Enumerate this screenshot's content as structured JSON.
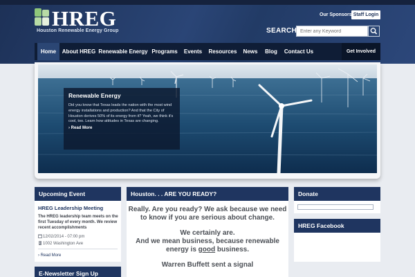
{
  "header": {
    "logo_text": "HREG",
    "logo_subtitle": "Houston Renewable Energy Group",
    "sponsors_link": "Our Sponsors",
    "staff_login": "Staff Login",
    "search_label": "SEARCH",
    "search_placeholder": "Enter any Keyword",
    "search_icon": "search-icon"
  },
  "nav": {
    "items": [
      {
        "label": "Home"
      },
      {
        "label": "About HREG"
      },
      {
        "label": "Renewable Energy"
      },
      {
        "label": "Programs"
      },
      {
        "label": "Events"
      },
      {
        "label": "Resources"
      },
      {
        "label": "News"
      },
      {
        "label": "Blog"
      },
      {
        "label": "Contact Us"
      }
    ],
    "cta": "Get Involved"
  },
  "hero": {
    "title": "Renewable Energy",
    "text": "Did you know that Texas leads the nation with the most wind energy installations and production? And that the City of Houston derives 50% of its energy from it? Yeah, we think it's cool, too. Learn how attitudes in Texas are changing.",
    "more": "Read More"
  },
  "upcoming": {
    "heading": "Upcoming Event",
    "event_title": "HREG Leadership Meeting",
    "event_desc": "The HREG leadership team meets on the first Tuesday of every month. We review recent accomplishments",
    "date": "12/02/2014 - 07:00 pm",
    "address": "1002 Washington Ave",
    "more": "Read More"
  },
  "newsletter": {
    "heading": "E-Newsletter Sign Up"
  },
  "main": {
    "heading": "Houston. . . ARE YOU READY?",
    "para1": "Really. Are you ready? We ask because we need to know if you are serious about change.",
    "para2a": "We certainly are.",
    "para2b": "And we mean business, because renewable energy is",
    "para2c": "good",
    "para2d": "business.",
    "para3": "Warren Buffett sent a signal"
  },
  "donate": {
    "heading": "Donate"
  },
  "facebook": {
    "heading": "HREG Facebook"
  },
  "colors": {
    "navy": "#1f3560",
    "header": "#2a4576",
    "accent_green": "#8fc77a"
  }
}
